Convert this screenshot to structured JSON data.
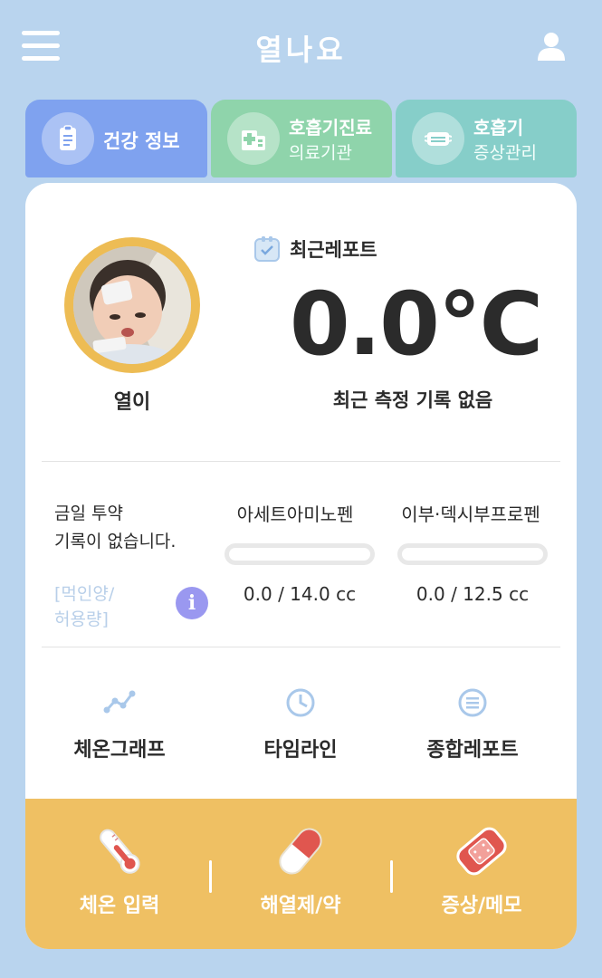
{
  "app": {
    "title": "열나요"
  },
  "tabs": {
    "health": {
      "label": "건강 정보"
    },
    "clinic": {
      "line1": "호흡기진료",
      "line2": "의료기관"
    },
    "symptom": {
      "line1": "호흡기",
      "line2": "증상관리"
    }
  },
  "profile": {
    "name": "열이"
  },
  "report": {
    "label": "최근레포트",
    "temperature": "0.0℃",
    "status": "최근 측정 기록 없음"
  },
  "medication": {
    "none_line1": "금일 투약",
    "none_line2": "기록이 없습니다.",
    "note_line1": "[먹인양/",
    "note_line2": "허용량]",
    "info_icon_glyph": "i",
    "items": [
      {
        "name": "아세트아미노펜",
        "amount": "0.0 / 14.0 cc",
        "progress": 0
      },
      {
        "name": "이부·덱시부프로펜",
        "amount": "0.0 / 12.5 cc",
        "progress": 0
      }
    ]
  },
  "shortcuts": [
    {
      "label": "체온그래프",
      "icon": "graph-icon"
    },
    {
      "label": "타임라인",
      "icon": "clock-icon"
    },
    {
      "label": "종합레포트",
      "icon": "list-icon"
    }
  ],
  "quick_actions": [
    {
      "label": "체온 입력",
      "icon": "thermometer-icon"
    },
    {
      "label": "해열제/약",
      "icon": "pill-icon"
    },
    {
      "label": "증상/메모",
      "icon": "bandage-icon"
    }
  ],
  "colors": {
    "background": "#b9d4ee",
    "tab_health": "#7fa2ef",
    "tab_clinic": "#8fd4ab",
    "tab_symptom": "#86cec9",
    "avatar_ring": "#edbc54",
    "quick_bar": "#efc063",
    "accent_blue": "#a9c8ea"
  }
}
